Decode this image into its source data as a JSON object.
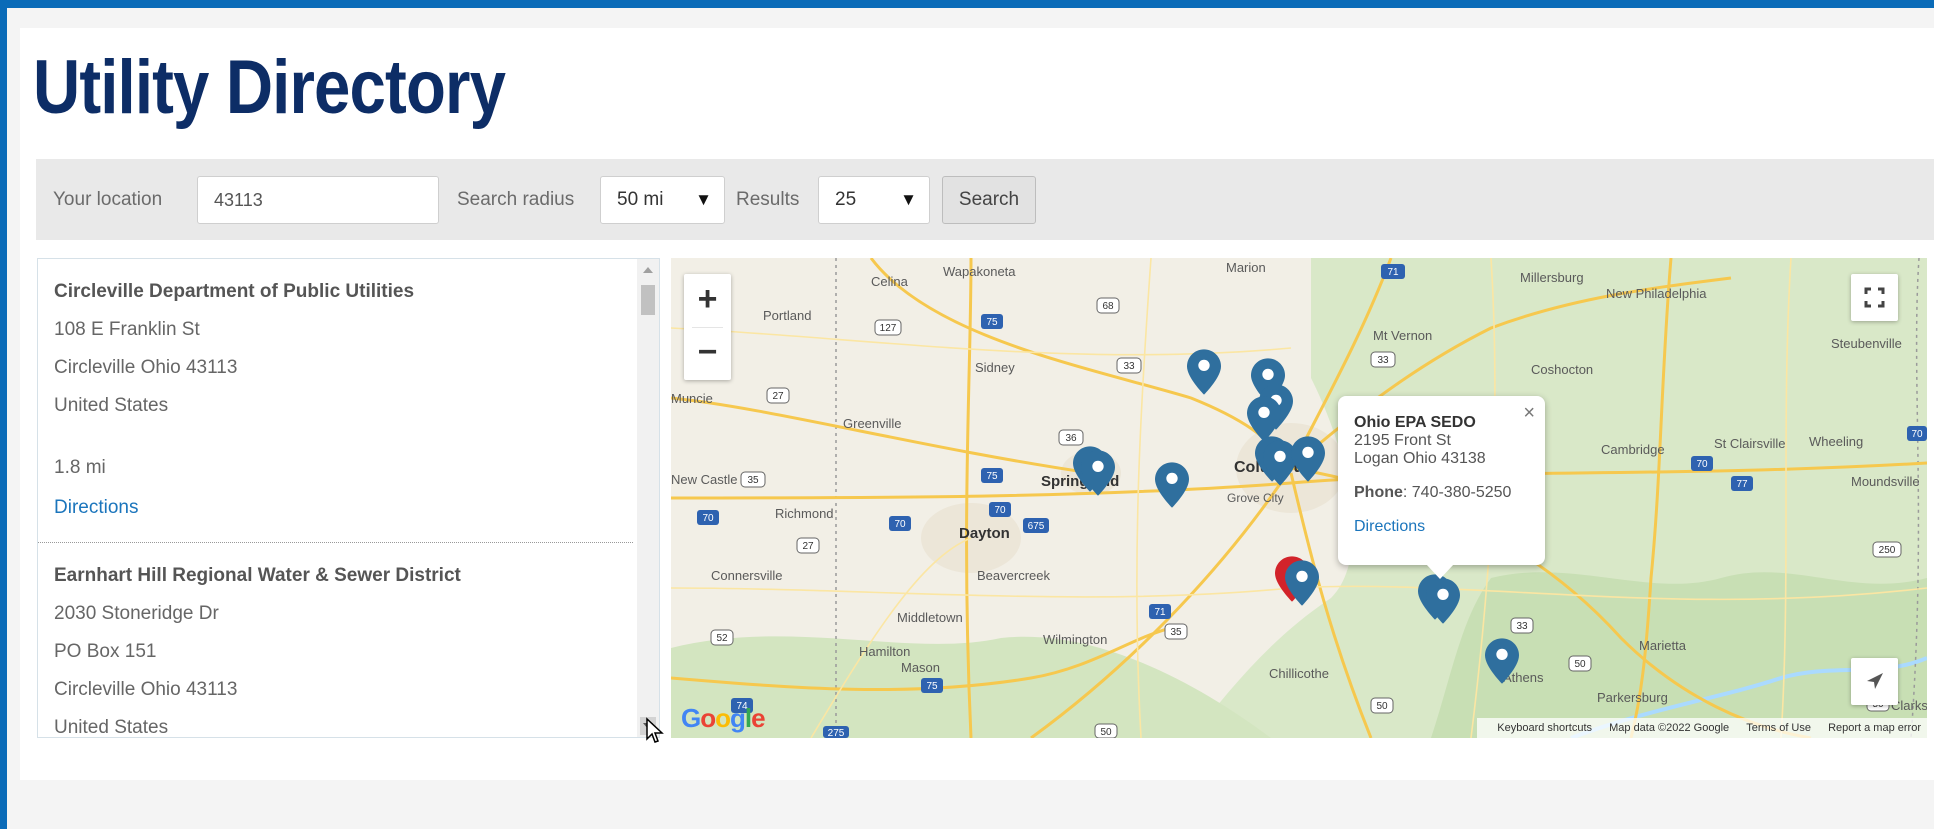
{
  "page": {
    "title": "Utility Directory"
  },
  "search": {
    "location_label": "Your location",
    "location_value": "43113",
    "radius_label": "Search radius",
    "radius_value": "50 mi",
    "results_label": "Results",
    "results_value": "25",
    "search_button": "Search"
  },
  "results": [
    {
      "name": "Circleville Department of Public Utilities",
      "lines": [
        "108 E Franklin St",
        "Circleville Ohio 43113",
        "United States"
      ],
      "distance": "1.8 mi",
      "directions": "Directions"
    },
    {
      "name": "Earnhart Hill Regional Water & Sewer District",
      "lines": [
        "2030 Stoneridge Dr",
        "PO Box 151",
        "Circleville Ohio 43113",
        "United States"
      ]
    }
  ],
  "map": {
    "zoom_in": "+",
    "zoom_out": "−",
    "popup": {
      "name": "Ohio EPA SEDO",
      "address": "2195 Front St",
      "city": "Logan Ohio 43138",
      "phone_label": "Phone",
      "phone": ": 740-380-5250",
      "directions": "Directions",
      "close": "×"
    },
    "credits": {
      "shortcuts": "Keyboard shortcuts",
      "data": "Map data ©2022 Google",
      "terms": "Terms of Use",
      "report": "Report a map error"
    },
    "logo": "Google",
    "places": [
      "Celina",
      "Wapakoneta",
      "Marion",
      "Millersburg",
      "New Philadelphia",
      "Portland",
      "Mt Vernon",
      "Steubenville",
      "Sidney",
      "Coshocton",
      "Muncie",
      "Greenville",
      "Cambridge",
      "St Clairsville",
      "Wheeling",
      "New Castle",
      "Springfield",
      "Columbus",
      "Moundsville",
      "Richmond",
      "Grove City",
      "Dayton",
      "Connersville",
      "Beavercreek",
      "Middletown",
      "Wilmington",
      "Hamilton",
      "Mason",
      "Chillicothe",
      "Marietta",
      "Athens",
      "Parkersburg",
      "Clarksburg"
    ],
    "highways": [
      "71",
      "68",
      "127",
      "75",
      "33",
      "36",
      "27",
      "35",
      "70",
      "77",
      "250",
      "52",
      "50",
      "74",
      "275",
      "675"
    ],
    "colors": {
      "marker": "#2f6f9e",
      "marker_active": "#d2232a",
      "water": "#aadaff",
      "park": "#c8dfb4"
    }
  }
}
